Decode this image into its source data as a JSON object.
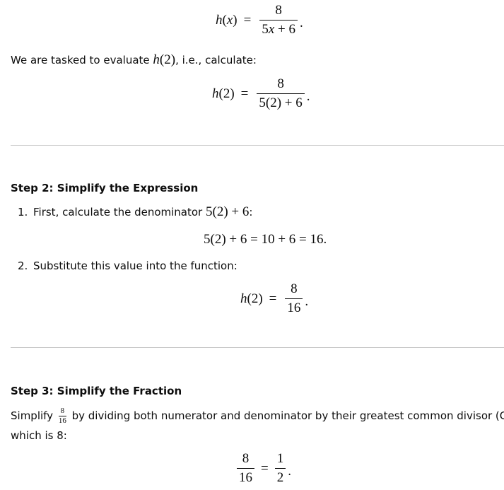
{
  "eq_hx": {
    "lhs": "h(x)",
    "lhs_fn": "h",
    "lhs_arg": "(x)",
    "equals": "=",
    "numerator": "8",
    "denominator": "5x + 6",
    "period": "."
  },
  "intro": {
    "text_before": "We are tasked to evaluate ",
    "math": "h(2)",
    "text_after": ", i.e., calculate:"
  },
  "eq_h2": {
    "lhs": "h(2)",
    "equals": "=",
    "numerator": "8",
    "denominator": "5(2) + 6",
    "period": "."
  },
  "step2": {
    "heading": "Step 2: Simplify the Expression",
    "items": [
      {
        "marker": "1.",
        "text": "First, calculate the denominator ",
        "math": "5(2) + 6",
        "suffix": ":"
      },
      {
        "marker": "2.",
        "text": "Substitute this value into the function:"
      }
    ],
    "eq_calc": "5(2) + 6 = 10 + 6 = 16.",
    "eq_h2_result": {
      "lhs": "h(2)",
      "equals": "=",
      "numerator": "8",
      "denominator": "16",
      "period": "."
    }
  },
  "step3": {
    "heading": "Step 3: Simplify the Fraction",
    "para_before": "Simplify ",
    "inline_frac": {
      "numerator": "8",
      "denominator": "16"
    },
    "para_after": " by dividing both numerator and denominator by their greatest common divisor (GCD),",
    "para_line2": "which is 8:",
    "eq_final": {
      "left_numerator": "8",
      "left_denominator": "16",
      "equals": "=",
      "right_numerator": "1",
      "right_denominator": "2",
      "period": "."
    }
  }
}
